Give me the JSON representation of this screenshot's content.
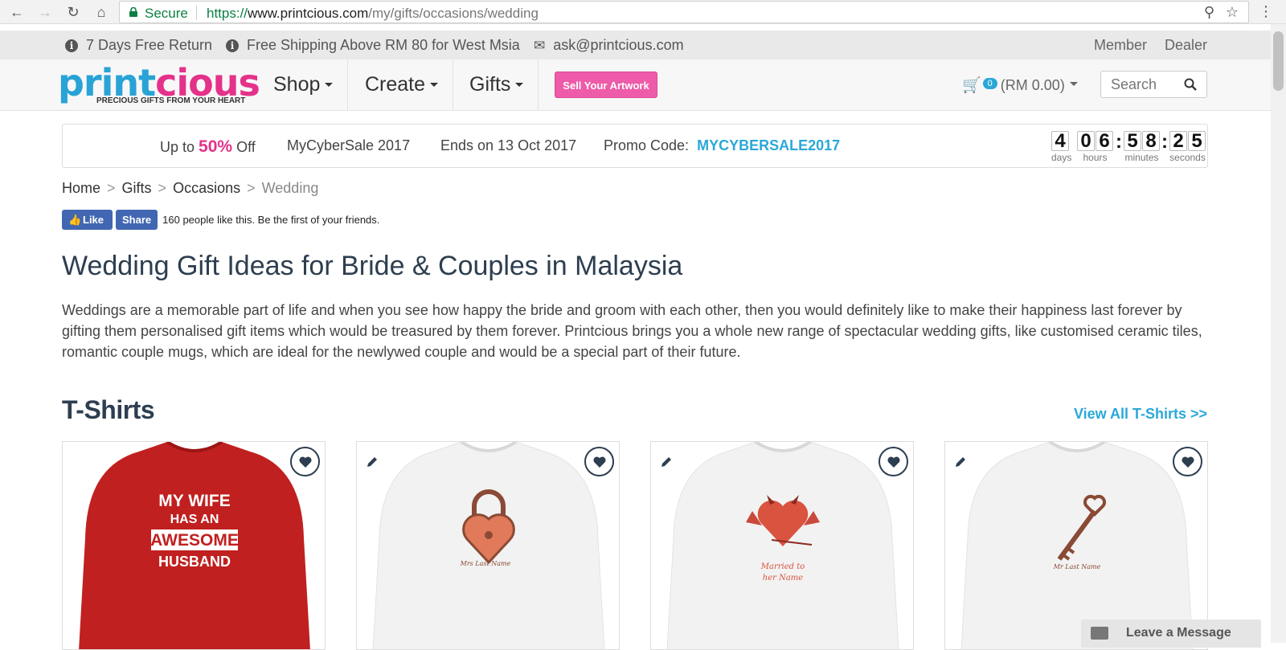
{
  "browser": {
    "secure_label": "Secure",
    "url_scheme": "https://",
    "url_host": "www.printcious.com",
    "url_path": "/my/gifts/occasions/wedding"
  },
  "infobar": {
    "free_return": "7 Days Free Return",
    "free_shipping": "Free Shipping Above RM 80 for West Msia",
    "email": "ask@printcious.com",
    "member": "Member",
    "dealer": "Dealer"
  },
  "logo": {
    "part1": "print",
    "part2": "cious",
    "tagline": "PRECIOUS GIFTS FROM YOUR HEART"
  },
  "nav": {
    "shop": "Shop",
    "create": "Create",
    "gifts": "Gifts",
    "sell": "Sell Your Artwork",
    "cart_count": "0",
    "cart_total": "(RM 0.00)",
    "search_placeholder": "Search"
  },
  "promo": {
    "upto": "Up to",
    "percent": "50%",
    "off": "Off",
    "sale_name": "MyCyberSale 2017",
    "ends": "Ends on 13 Oct 2017",
    "code_label": "Promo Code:",
    "code": "MYCYBERSALE2017",
    "countdown": {
      "days": [
        "4"
      ],
      "hours": [
        "0",
        "6"
      ],
      "minutes": [
        "5",
        "8"
      ],
      "seconds": [
        "2",
        "5"
      ],
      "labels": {
        "days": "days",
        "hours": "hours",
        "minutes": "minutes",
        "seconds": "seconds"
      }
    }
  },
  "breadcrumb": {
    "home": "Home",
    "gifts": "Gifts",
    "occasions": "Occasions",
    "current": "Wedding",
    "sep": ">"
  },
  "facebook": {
    "like": "Like",
    "share": "Share",
    "text": "160 people like this. Be the first of your friends."
  },
  "page": {
    "title": "Wedding Gift Ideas for Bride & Couples in Malaysia",
    "description": "Weddings are a memorable part of life and when you see how happy the bride and groom with each other, then you would definitely like to make their happiness last forever by gifting them personalised gift items which would be treasured by them forever. Printcious brings you a whole new range of spectacular wedding gifts, like customised ceramic tiles, romantic couple mugs, which are ideal for the newlywed couple and would be a special part of their future."
  },
  "section": {
    "title": "T-Shirts",
    "view_all": "View All T-Shirts >>"
  },
  "products": [
    {
      "shirt_color": "#c0201f",
      "print_lines": [
        "MY WIFE",
        "HAS AN",
        "AWESOME",
        "HUSBAND"
      ],
      "editable": false
    },
    {
      "shirt_color": "#f2f2f2",
      "print_lines": [
        "Mrs Last Name"
      ],
      "design": "padlock-heart",
      "editable": true
    },
    {
      "shirt_color": "#f2f2f2",
      "print_lines": [
        "Married to",
        "her Name"
      ],
      "design": "devil-heart",
      "editable": true
    },
    {
      "shirt_color": "#f2f2f2",
      "print_lines": [
        "Mr Last Name"
      ],
      "design": "heart-key",
      "editable": true
    }
  ],
  "chat": {
    "label": "Leave a Message"
  },
  "colors": {
    "brand_blue": "#29a3d6",
    "brand_pink": "#e4328a",
    "heading": "#2d3e50"
  }
}
